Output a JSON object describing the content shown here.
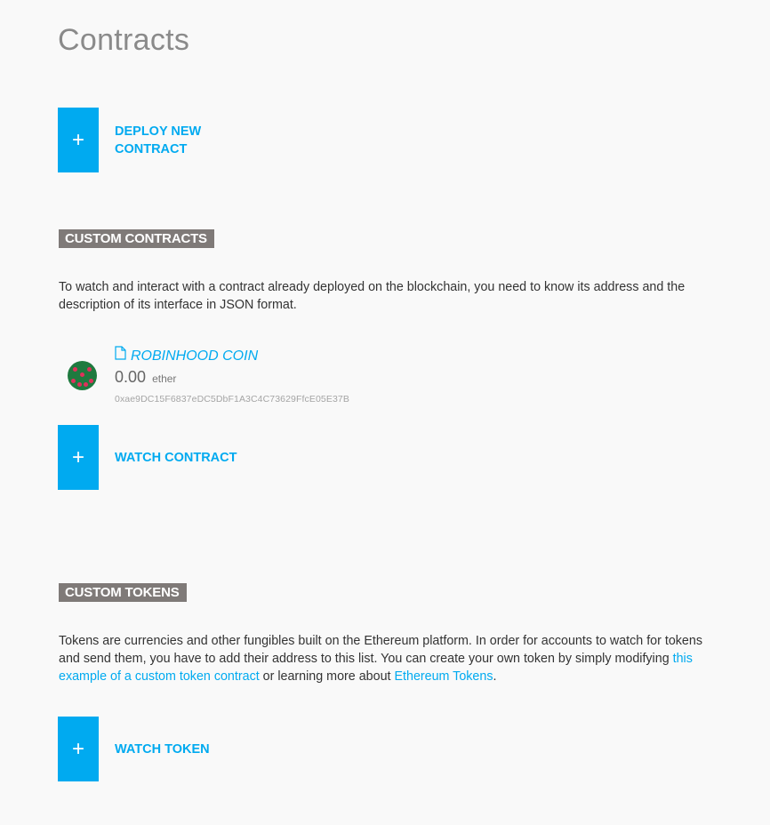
{
  "page": {
    "title": "Contracts"
  },
  "deploy": {
    "plus": "+",
    "label": "DEPLOY NEW CONTRACT"
  },
  "custom_contracts": {
    "header": "CUSTOM CONTRACTS",
    "description": "To watch and interact with a contract already deployed on the blockchain, you need to know its address and the description of its interface in JSON format.",
    "items": [
      {
        "name": "ROBINHOOD COIN",
        "balance": "0.00",
        "unit": "ether",
        "address": "0xae9DC15F6837eDC5DbF1A3C4C73629FfcE05E37B",
        "icon": "file-document-icon"
      }
    ],
    "watch_plus": "+",
    "watch_label": "WATCH CONTRACT"
  },
  "custom_tokens": {
    "header": "CUSTOM TOKENS",
    "description_1": "Tokens are currencies and other fungibles built on the Ethereum platform. In order for accounts to watch for tokens and send them, you have to add their address to this list. You can create your own token by simply modifying ",
    "link_1": "this example of a custom token contract",
    "description_2": " or learning more about ",
    "link_2": "Ethereum Tokens",
    "description_3": ".",
    "watch_plus": "+",
    "watch_label": "WATCH TOKEN"
  },
  "colors": {
    "accent": "#00aaf0",
    "section_header_bg": "#7f7a78",
    "background": "#f9f9f9"
  }
}
